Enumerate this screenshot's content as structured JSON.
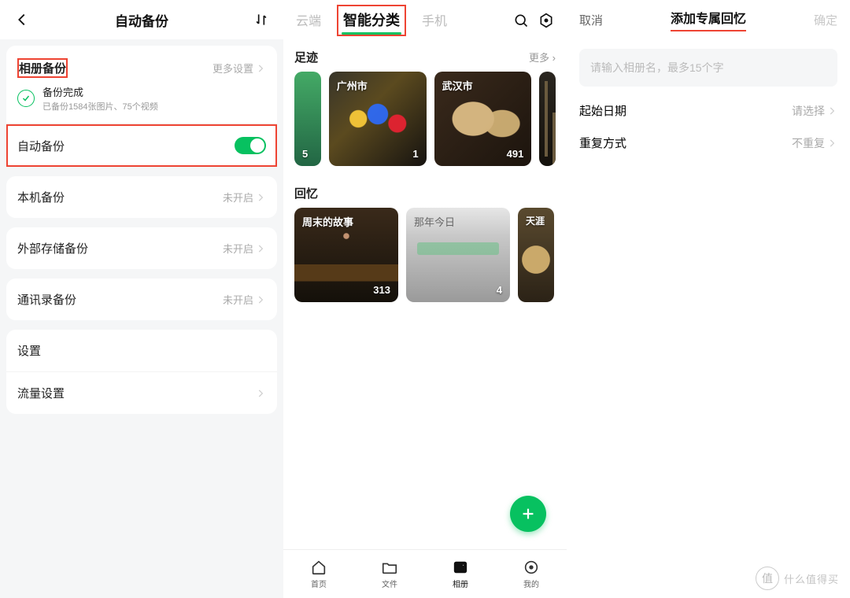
{
  "pane1": {
    "title": "自动备份",
    "section1": {
      "heading": "相册备份",
      "more": "更多设置",
      "status_title": "备份完成",
      "status_sub": "已备份1584张图片、75个视频",
      "auto_label": "自动备份"
    },
    "rows": {
      "local": {
        "label": "本机备份",
        "value": "未开启"
      },
      "ext": {
        "label": "外部存储备份",
        "value": "未开启"
      },
      "contacts": {
        "label": "通讯录备份",
        "value": "未开启"
      },
      "settings": {
        "label": "设置"
      },
      "traffic": {
        "label": "流量设置"
      }
    }
  },
  "pane2": {
    "tabs": {
      "cloud": "云端",
      "smart": "智能分类",
      "phone": "手机"
    },
    "sections": {
      "footprint": {
        "title": "足迹",
        "more": "更多",
        "items": [
          {
            "name": "",
            "count": "5"
          },
          {
            "name": "广州市",
            "count": "1"
          },
          {
            "name": "武汉市",
            "count": "491"
          }
        ]
      },
      "memory": {
        "title": "回忆",
        "items": [
          {
            "name": "周末的故事",
            "count": "313"
          },
          {
            "name": "那年今日",
            "count": "4"
          },
          {
            "name": "天涯"
          }
        ]
      }
    },
    "nav": {
      "home": "首页",
      "files": "文件",
      "album": "相册",
      "mine": "我的"
    }
  },
  "pane3": {
    "cancel": "取消",
    "title": "添加专属回忆",
    "ok": "确定",
    "placeholder": "请输入相册名，最多15个字",
    "rows": {
      "start": {
        "label": "起始日期",
        "value": "请选择"
      },
      "repeat": {
        "label": "重复方式",
        "value": "不重复"
      }
    }
  },
  "watermark": {
    "badge": "值",
    "text": "什么值得买"
  }
}
